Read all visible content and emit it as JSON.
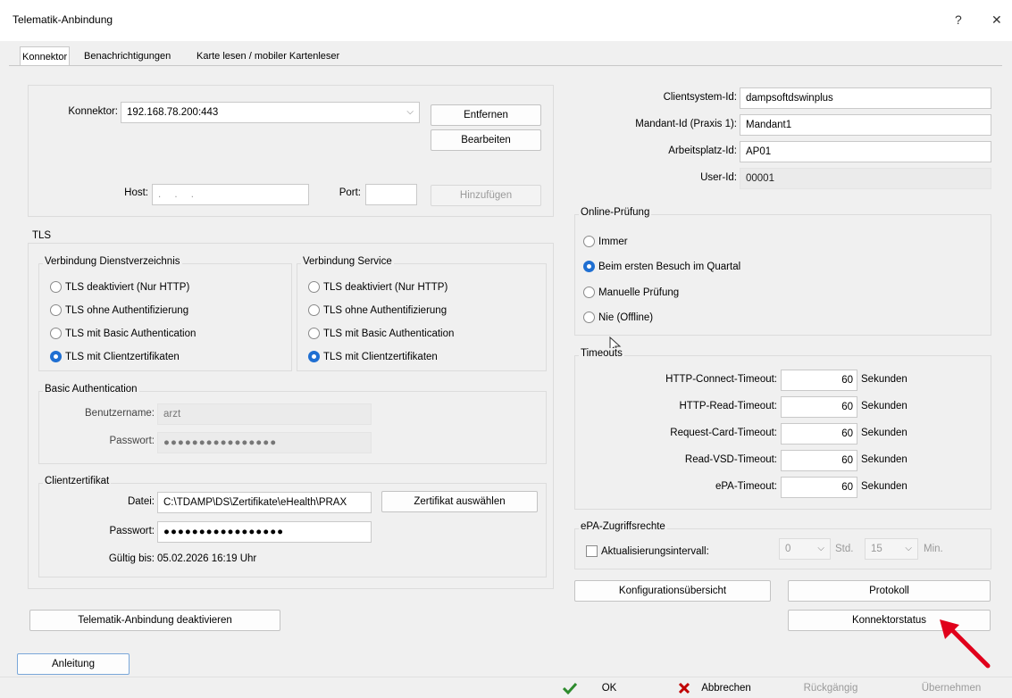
{
  "window": {
    "title": "Telematik-Anbindung",
    "help": "?",
    "close": "✕"
  },
  "tabs": [
    {
      "label": "Konnektor"
    },
    {
      "label": "Benachrichtigungen"
    },
    {
      "label": "Karte lesen / mobiler Kartenleser"
    }
  ],
  "konnektor": {
    "label": "Konnektor:",
    "value": "192.168.78.200:443",
    "remove_button": "Entfernen",
    "edit_button": "Bearbeiten",
    "host_label": "Host:",
    "host_value": ".   .   .",
    "port_label": "Port:",
    "port_value": "",
    "add_button": "Hinzufügen"
  },
  "tls": {
    "title": "TLS",
    "dienst": {
      "title": "Verbindung Dienstverzeichnis",
      "options": [
        "TLS deaktiviert (Nur HTTP)",
        "TLS ohne Authentifizierung",
        "TLS mit Basic Authentication",
        "TLS mit Clientzertifikaten"
      ],
      "selected": 3
    },
    "service": {
      "title": "Verbindung Service",
      "options": [
        "TLS deaktiviert (Nur HTTP)",
        "TLS ohne Authentifizierung",
        "TLS mit Basic Authentication",
        "TLS mit Clientzertifikaten"
      ],
      "selected": 3
    },
    "basic_auth": {
      "title": "Basic Authentication",
      "user_label": "Benutzername:",
      "user_value": "arzt",
      "pass_label": "Passwort:",
      "pass_value": "●●●●●●●●●●●●●●●●"
    },
    "client_cert": {
      "title": "Clientzertifikat",
      "file_label": "Datei:",
      "file_value": "C:\\TDAMP\\DS\\Zertifikate\\eHealth\\PRAX",
      "select_button": "Zertifikat auswählen",
      "pass_label": "Passwort:",
      "pass_value": "●●●●●●●●●●●●●●●●●",
      "valid_label": "Gültig bis:",
      "valid_value": "05.02.2026 16:19 Uhr"
    }
  },
  "deactivate_button": "Telematik-Anbindung deaktivieren",
  "ids": {
    "client_label": "Clientsystem-Id:",
    "client_value": "dampsoftdswinplus",
    "mandant_label": "Mandant-Id (Praxis 1):",
    "mandant_value": "Mandant1",
    "arbeitsplatz_label": "Arbeitsplatz-Id:",
    "arbeitsplatz_value": "AP01",
    "user_label": "User-Id:",
    "user_value": "00001"
  },
  "online": {
    "title": "Online-Prüfung",
    "options": [
      "Immer",
      "Beim ersten Besuch im Quartal",
      "Manuelle Prüfung",
      "Nie (Offline)"
    ],
    "selected": 1
  },
  "timeouts": {
    "title": "Timeouts",
    "unit": "Sekunden",
    "rows": [
      {
        "label": "HTTP-Connect-Timeout:",
        "value": "60"
      },
      {
        "label": "HTTP-Read-Timeout:",
        "value": "60"
      },
      {
        "label": "Request-Card-Timeout:",
        "value": "60"
      },
      {
        "label": "Read-VSD-Timeout:",
        "value": "60"
      },
      {
        "label": "ePA-Timeout:",
        "value": "60"
      }
    ]
  },
  "epa": {
    "title": "ePA-Zugriffsrechte",
    "checkbox_label": "Aktualisierungsintervall:",
    "hours_value": "0",
    "hours_unit": "Std.",
    "minutes_value": "15",
    "minutes_unit": "Min."
  },
  "buttons": {
    "overview": "Konfigurationsübersicht",
    "protocol": "Protokoll",
    "status": "Konnektorstatus",
    "guide": "Anleitung"
  },
  "footer": {
    "ok": "OK",
    "cancel": "Abbrechen",
    "undo": "Rückgängig",
    "apply": "Übernehmen"
  },
  "colors": {
    "accent": "#1f6fd2",
    "ok_check": "#2e8b2e",
    "cancel_x": "#c00000",
    "arrow": "#e0001b"
  }
}
